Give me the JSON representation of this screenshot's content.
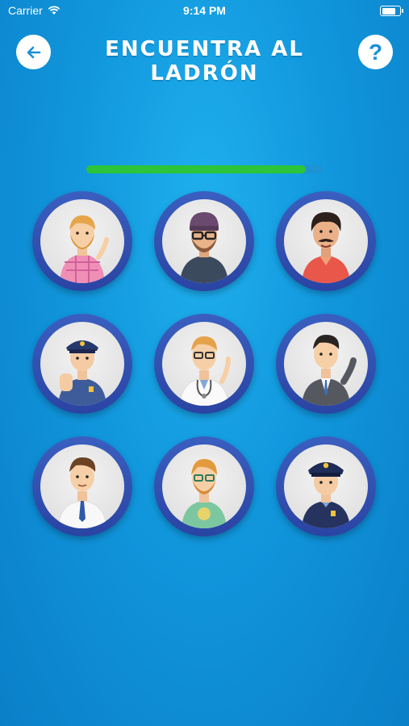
{
  "status_bar": {
    "carrier": "Carrier",
    "time": "9:14 PM"
  },
  "header": {
    "title": "ENCUENTRA AL LADRÓN",
    "help_label": "?"
  },
  "progress": {
    "fraction": 0.93
  },
  "colors": {
    "accent": "#2bc43a",
    "ring": "#2a44a3",
    "background": "#1196dc"
  },
  "avatars": [
    {
      "name": "blond-bearded-man-pink-shirt",
      "icon": "person-icon"
    },
    {
      "name": "burglar-beanie-mask",
      "icon": "person-icon"
    },
    {
      "name": "mustache-man-red-shirt",
      "icon": "person-icon"
    },
    {
      "name": "police-officer-stop",
      "icon": "person-icon"
    },
    {
      "name": "doctor-stethoscope",
      "icon": "person-icon"
    },
    {
      "name": "businessman-grey-suit",
      "icon": "person-icon"
    },
    {
      "name": "man-white-shirt-tie",
      "icon": "person-icon"
    },
    {
      "name": "redhead-man-green-shirt",
      "icon": "person-icon"
    },
    {
      "name": "police-officer-cap",
      "icon": "person-icon"
    }
  ]
}
